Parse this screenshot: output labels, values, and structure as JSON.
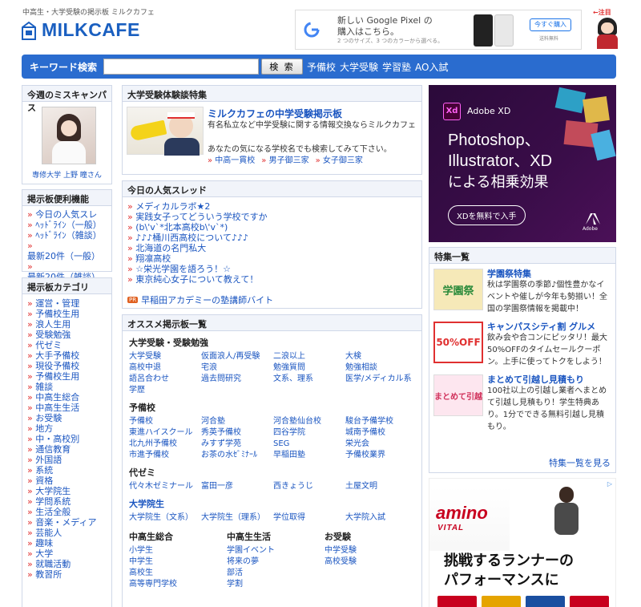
{
  "header": {
    "tagline": "中高生・大学受験の掲示板 ミルクカフェ",
    "logo_text": "MILKCAFE"
  },
  "top_ad": {
    "line1": "新しい Google Pixel の",
    "line2": "購入はこちら。",
    "line3": "2 つのサイズ、3 つのカラーから選べる。",
    "button": "今すぐ購入",
    "note": "送料無料"
  },
  "mascot": {
    "badge": "←注目"
  },
  "search": {
    "label": "キーワード検索",
    "button": "検 索",
    "links": [
      "予備校",
      "大学受験",
      "学習塾",
      "AO入試"
    ]
  },
  "miss_campus": {
    "title": "今週のミスキャンパス",
    "caption": "専修大学 上野 瞳さん"
  },
  "tools": {
    "title": "掲示板便利機能",
    "items": [
      "今日の人気スレ",
      "ﾍｯﾄﾞﾗｲﾝ（一般）",
      "ﾍｯﾄﾞﾗｲﾝ（雑談）",
      "最新20件（一般）",
      "最新20件（雑談）"
    ]
  },
  "categories": {
    "title": "掲示板カテゴリ",
    "items": [
      "運営・管理",
      "予備校生用",
      "浪人生用",
      "受験勉強",
      "代ゼミ",
      "大手予備校",
      "現役予備校",
      "予備校生用",
      "雑談",
      "中高生総合",
      "中高生生活",
      "お受験",
      "地方",
      "中・高校別",
      "通信教育",
      "外国語",
      "系統",
      "資格",
      "大学院生",
      "学問系統",
      "生活全般",
      "音楽・メディア",
      "芸能人",
      "趣味",
      "大学",
      "就職活動",
      "教習所"
    ]
  },
  "experience": {
    "title": "大学受験体験談特集",
    "headline": "ミルクカフェの中学受験掲示板",
    "desc1": "有名私立など中学受験に関する情報交換ならミルクカフェ",
    "desc2": "あなたの気になる学校名でも検索してみて下さい。",
    "links": [
      "中高一貫校",
      "男子御三家",
      "女子御三家"
    ]
  },
  "popular": {
    "title": "今日の人気スレッド",
    "items": [
      "メディカルラボ★2",
      "実践女子ってどういう学校ですか",
      "(b\\'v`*北本高校b\\'v`*)",
      "♪♪♪桶川西高校について♪♪♪",
      "北海道の名門私大",
      "翔凛高校",
      "☆栄光学園を語ろう！☆",
      "東京純心女子について教えて！"
    ],
    "pr_badge": "PR",
    "pr_text": "早稲田アカデミーの塾講師バイト"
  },
  "recommend": {
    "title": "オススメ掲示板一覧",
    "sections": [
      {
        "name": "大学受験・受験勉強",
        "items": [
          "大学受験",
          "仮面浪人/再受験",
          "二浪以上",
          "大検",
          "高校中退",
          "宅浪",
          "勉強質問",
          "勉強相談",
          "語呂合わせ",
          "過去問研究",
          "文系、理系",
          "医学/メディカル系",
          "学歴"
        ]
      },
      {
        "name": "予備校",
        "items": [
          "予備校",
          "河合塾",
          "河合塾仙台校",
          "駿台予備学校",
          "東進ハイスクール",
          "秀英予備校",
          "四谷学院",
          "城南予備校",
          "北九州予備校",
          "みすず学苑",
          "SEG",
          "栄光会",
          "市進予備校",
          "お茶の水ｾﾞﾐﾅｰﾙ",
          "早稲田塾",
          "予備校業界"
        ]
      },
      {
        "name": "代ゼミ",
        "items": [
          "代々木ゼミナール",
          "富田一彦",
          "西きょうじ",
          "土屋文明"
        ]
      },
      {
        "name": "大学院生",
        "items": [
          "大学院生（文系）",
          "大学院生（理系）",
          "学位取得",
          "大学院入試"
        ]
      }
    ],
    "bottom": [
      {
        "name": "中高生総合",
        "items": [
          "小学生",
          "中学生",
          "高校生",
          "高等専門学校"
        ]
      },
      {
        "name": "中高生生活",
        "items": [
          "学園イベント",
          "将来の夢",
          "部活",
          "学割"
        ]
      },
      {
        "name": "お受験",
        "items": [
          "中学受験",
          "高校受験"
        ]
      }
    ]
  },
  "adobe_ad": {
    "brand": "Adobe XD",
    "line1": "Photoshop、",
    "line2": "Illustrator、XD",
    "line3": "による相乗効果",
    "cta": "XDを無料で入手",
    "logo": "Adobe"
  },
  "features": {
    "title": "特集一覧",
    "items": [
      {
        "title": "学園祭特集",
        "desc": "秋は学園祭の季節♪個性豊かなイベントや催しが今年も勢揃い！全国の学園祭情報を掲載中！",
        "thumb": "学園祭"
      },
      {
        "title": "キャンパスシティ割 グルメ",
        "desc": "飲み会や合コンにピッタリ！最大50%OFFのタイムセールクーポン。上手に使ってトクをしよう！",
        "thumb": "50%OFF"
      },
      {
        "title": "まとめて引越し見積もり",
        "desc": "100社以上の引越し業者へまとめて引越し見積もり！学生特典あり。1分でできる無料引越し見積もり。",
        "thumb": "まとめて引越"
      }
    ],
    "more": "特集一覧を見る"
  },
  "amino_ad": {
    "brand": "amino",
    "brand2": "VITAL",
    "line1": "挑戦するランナーの",
    "line2": "パフォーマンスに"
  }
}
